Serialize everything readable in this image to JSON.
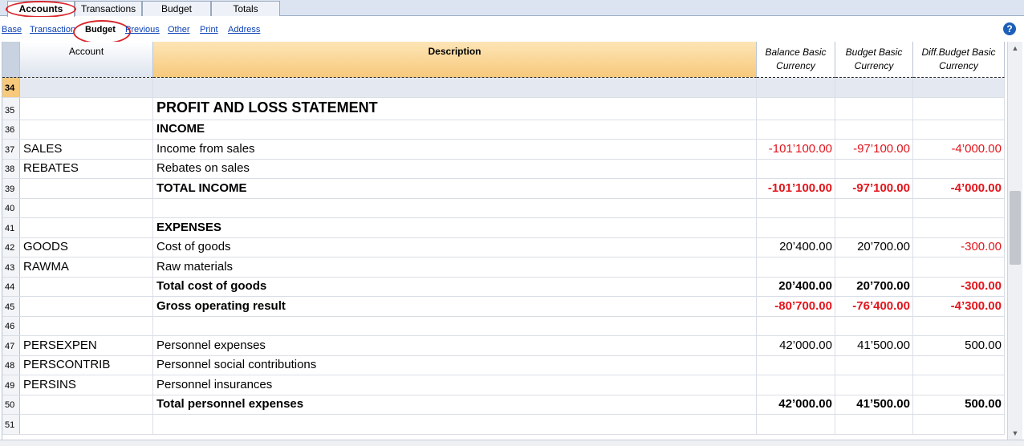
{
  "tabs": [
    {
      "label": "Accounts",
      "active": true
    },
    {
      "label": "Transactions",
      "active": false
    },
    {
      "label": "Budget",
      "active": false
    },
    {
      "label": "Totals",
      "active": false
    }
  ],
  "views": [
    {
      "label": "Base",
      "active": false
    },
    {
      "label": "Transaction",
      "active": false
    },
    {
      "label": "Budget",
      "active": true
    },
    {
      "label": "Previous",
      "active": false
    },
    {
      "label": "Other",
      "active": false
    },
    {
      "label": "Print",
      "active": false
    },
    {
      "label": "Address",
      "active": false
    }
  ],
  "help_label": "?",
  "columns": {
    "account": "Account",
    "description": "Description",
    "balance_l1": "Balance Basic",
    "balance_l2": "Currency",
    "budget_l1": "Budget Basic",
    "budget_l2": "Currency",
    "diff_l1": "Diff.Budget Basic",
    "diff_l2": "Currency"
  },
  "rows": [
    {
      "num": "34",
      "account": "",
      "description": "",
      "balance": "",
      "budget": "",
      "diff": "",
      "style": "sel"
    },
    {
      "num": "35",
      "account": "",
      "description": "PROFIT AND LOSS STATEMENT",
      "balance": "",
      "budget": "",
      "diff": "",
      "style": "title"
    },
    {
      "num": "36",
      "account": "",
      "description": "INCOME",
      "balance": "",
      "budget": "",
      "diff": "",
      "style": "b"
    },
    {
      "num": "37",
      "account": "SALES",
      "description": "Income from sales",
      "balance": "-101’100.00",
      "budget": "-97’100.00",
      "diff": "-4’000.00",
      "style": ""
    },
    {
      "num": "38",
      "account": "REBATES",
      "description": "Rebates on sales",
      "balance": "",
      "budget": "",
      "diff": "",
      "style": ""
    },
    {
      "num": "39",
      "account": "",
      "description": "TOTAL INCOME",
      "balance": "-101’100.00",
      "budget": "-97’100.00",
      "diff": "-4’000.00",
      "style": "b"
    },
    {
      "num": "40",
      "account": "",
      "description": "",
      "balance": "",
      "budget": "",
      "diff": "",
      "style": ""
    },
    {
      "num": "41",
      "account": "",
      "description": "EXPENSES",
      "balance": "",
      "budget": "",
      "diff": "",
      "style": "b"
    },
    {
      "num": "42",
      "account": "GOODS",
      "description": "Cost of goods",
      "balance": "20’400.00",
      "budget": "20’700.00",
      "diff": "-300.00",
      "style": ""
    },
    {
      "num": "43",
      "account": "RAWMA",
      "description": "Raw materials",
      "balance": "",
      "budget": "",
      "diff": "",
      "style": ""
    },
    {
      "num": "44",
      "account": "",
      "description": "Total cost of goods",
      "balance": "20’400.00",
      "budget": "20’700.00",
      "diff": "-300.00",
      "style": "b"
    },
    {
      "num": "45",
      "account": "",
      "description": "Gross operating result",
      "balance": "-80’700.00",
      "budget": "-76’400.00",
      "diff": "-4’300.00",
      "style": "b"
    },
    {
      "num": "46",
      "account": "",
      "description": "",
      "balance": "",
      "budget": "",
      "diff": "",
      "style": ""
    },
    {
      "num": "47",
      "account": "PERSEXPEN",
      "description": "Personnel expenses",
      "balance": "42’000.00",
      "budget": "41’500.00",
      "diff": "500.00",
      "style": ""
    },
    {
      "num": "48",
      "account": "PERSCONTRIB",
      "description": "Personnel social contributions",
      "balance": "",
      "budget": "",
      "diff": "",
      "style": ""
    },
    {
      "num": "49",
      "account": "PERSINS",
      "description": "Personnel insurances",
      "balance": "",
      "budget": "",
      "diff": "",
      "style": ""
    },
    {
      "num": "50",
      "account": "",
      "description": "Total personnel expenses",
      "balance": "42’000.00",
      "budget": "41’500.00",
      "diff": "500.00",
      "style": "b"
    },
    {
      "num": "51",
      "account": "",
      "description": "",
      "balance": "",
      "budget": "",
      "diff": "",
      "style": ""
    }
  ],
  "colors": {
    "negative": "#e2151b",
    "highlight_circle": "#d8262b",
    "selected_row_number": "#f7c97c"
  }
}
